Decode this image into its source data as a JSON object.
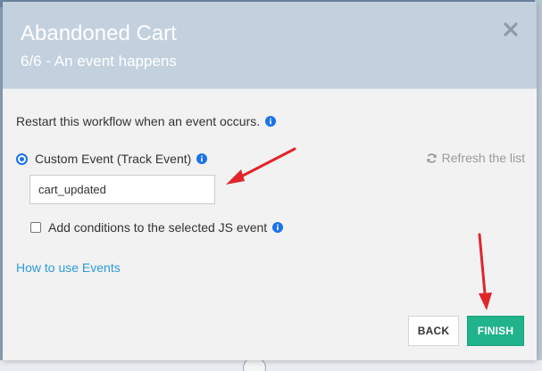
{
  "modal": {
    "title": "Abandoned Cart",
    "subtitle": "6/6 - An event happens",
    "close_icon": "close-icon"
  },
  "body": {
    "intro": "Restart this workflow when an event occurs.",
    "radio_label": "Custom Event (Track Event)",
    "refresh_label": "Refresh the list",
    "event_input_value": "cart_updated",
    "conditions_label": "Add conditions to the selected JS event",
    "howto_link": "How to use Events"
  },
  "footer": {
    "back_label": "BACK",
    "finish_label": "FINISH"
  },
  "colors": {
    "header_bg": "#c3d1de",
    "accent_blue": "#1a73e8",
    "link_blue": "#2b9bd9",
    "finish_green": "#20b38c",
    "annotation_red": "#e0262b"
  },
  "icons": {
    "info": "info-icon",
    "refresh": "refresh-icon",
    "annotation_arrows": "red-arrow-icon"
  }
}
